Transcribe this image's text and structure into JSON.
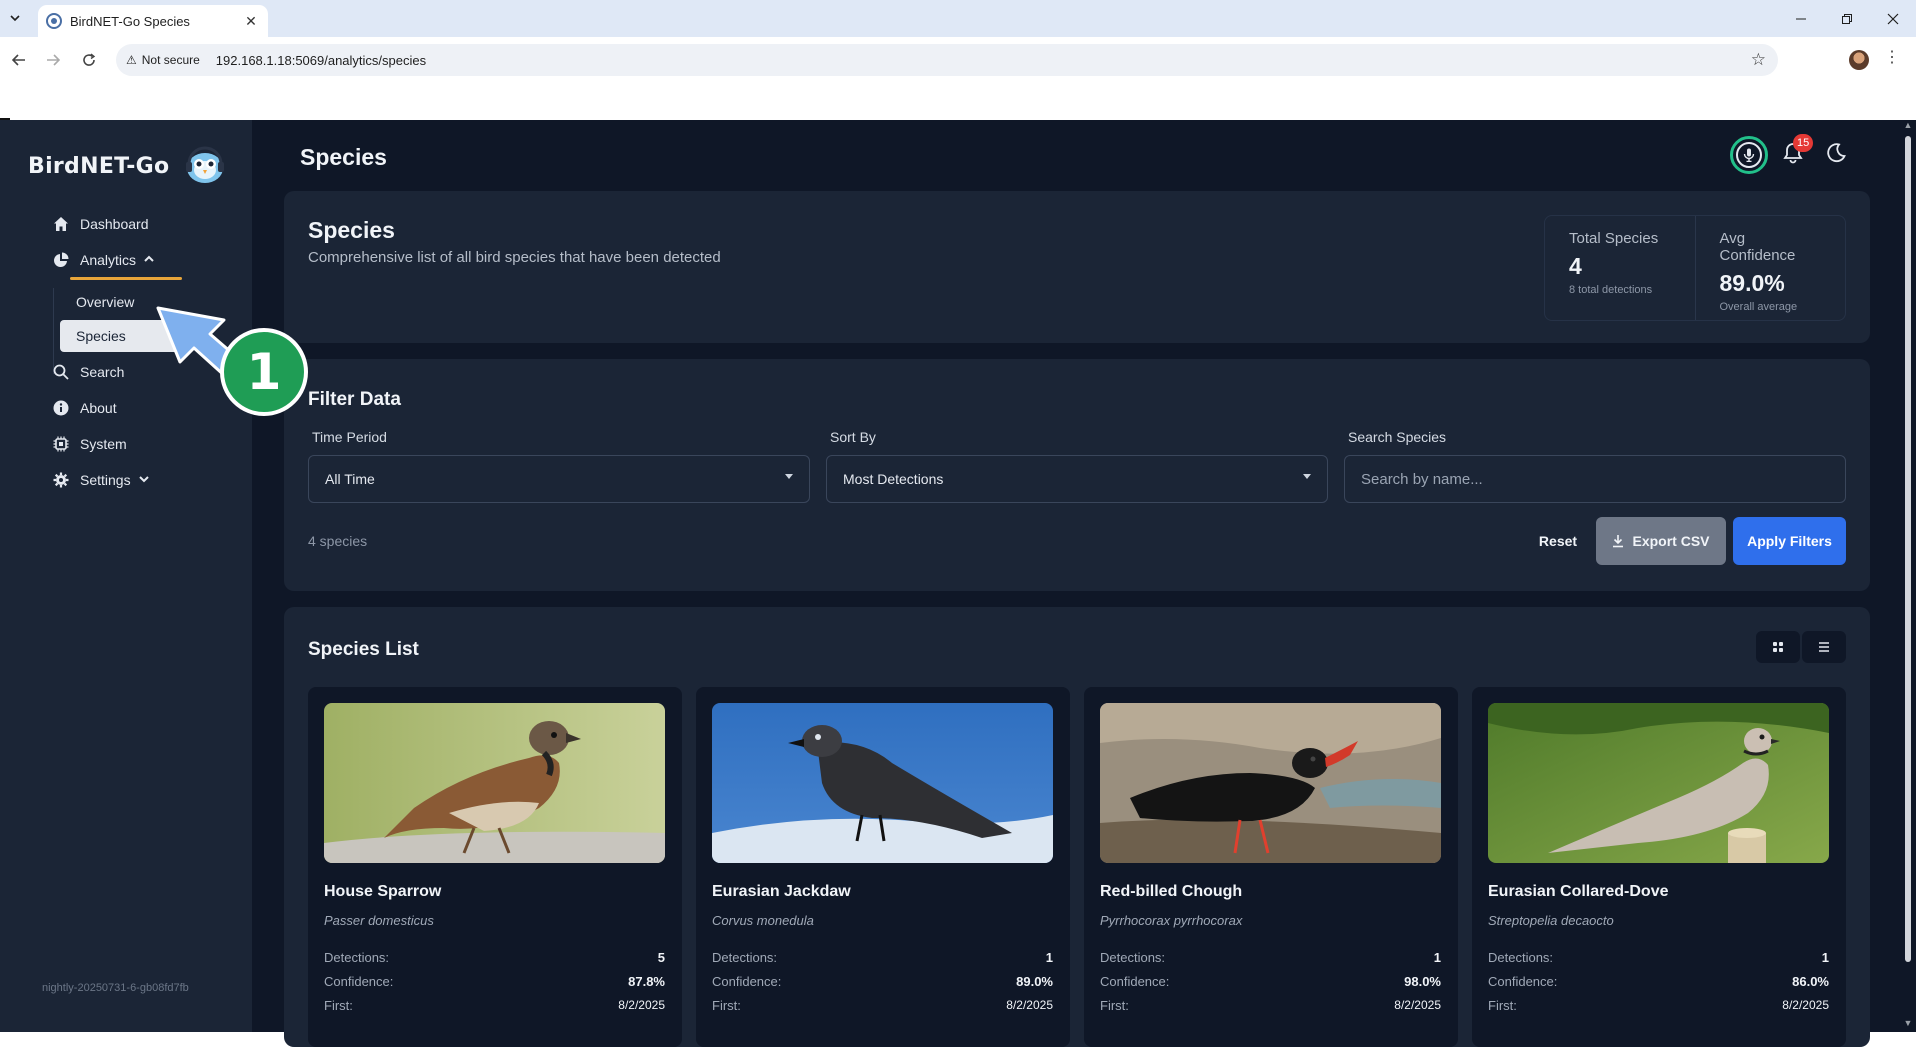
{
  "browser": {
    "tab_title": "BirdNET-Go Species",
    "security_label": "Not secure",
    "url": "192.168.1.18:5069/analytics/species"
  },
  "sidebar": {
    "brand": "BirdNET-Go",
    "items": [
      {
        "label": "Dashboard",
        "icon": "home-icon"
      },
      {
        "label": "Analytics",
        "icon": "pie-chart-icon",
        "expanded": true
      },
      {
        "label": "Search",
        "icon": "search-icon"
      },
      {
        "label": "About",
        "icon": "info-icon"
      },
      {
        "label": "System",
        "icon": "chip-icon"
      },
      {
        "label": "Settings",
        "icon": "gear-icon"
      }
    ],
    "analytics_sub": [
      {
        "label": "Overview"
      },
      {
        "label": "Species",
        "active": true
      }
    ],
    "version": "nightly-20250731-6-gb08fd7fb"
  },
  "header": {
    "title": "Species",
    "notification_count": "15"
  },
  "summary": {
    "title": "Species",
    "description": "Comprehensive list of all bird species that have been detected",
    "stats": [
      {
        "label": "Total Species",
        "value": "4",
        "sub": "8 total detections"
      },
      {
        "label": "Avg Confidence",
        "value": "89.0%",
        "sub": "Overall average"
      }
    ]
  },
  "filter": {
    "title": "Filter Data",
    "time_period_label": "Time Period",
    "time_period_value": "All Time",
    "sort_by_label": "Sort By",
    "sort_by_value": "Most Detections",
    "search_label": "Search Species",
    "search_placeholder": "Search by name...",
    "species_count": "4 species",
    "reset_label": "Reset",
    "export_label": "Export CSV",
    "apply_label": "Apply Filters"
  },
  "species_list": {
    "title": "Species List",
    "labels": {
      "detections": "Detections:",
      "confidence": "Confidence:",
      "first": "First:"
    },
    "items": [
      {
        "common": "House Sparrow",
        "scientific": "Passer domesticus",
        "detections": "5",
        "confidence": "87.8%",
        "first": "8/2/2025"
      },
      {
        "common": "Eurasian Jackdaw",
        "scientific": "Corvus monedula",
        "detections": "1",
        "confidence": "89.0%",
        "first": "8/2/2025"
      },
      {
        "common": "Red-billed Chough",
        "scientific": "Pyrrhocorax pyrrhocorax",
        "detections": "1",
        "confidence": "98.0%",
        "first": "8/2/2025"
      },
      {
        "common": "Eurasian Collared-Dove",
        "scientific": "Streptopelia decaocto",
        "detections": "1",
        "confidence": "86.0%",
        "first": "8/2/2025"
      }
    ]
  },
  "annotation": {
    "step_number": "1"
  },
  "colors": {
    "app_bg": "#0f1727",
    "card_bg": "#1b2536",
    "accent_blue": "#2f6fec",
    "accent_orange": "#e8a53a",
    "badge_red": "#e53935",
    "callout_green": "#1f9d55"
  }
}
